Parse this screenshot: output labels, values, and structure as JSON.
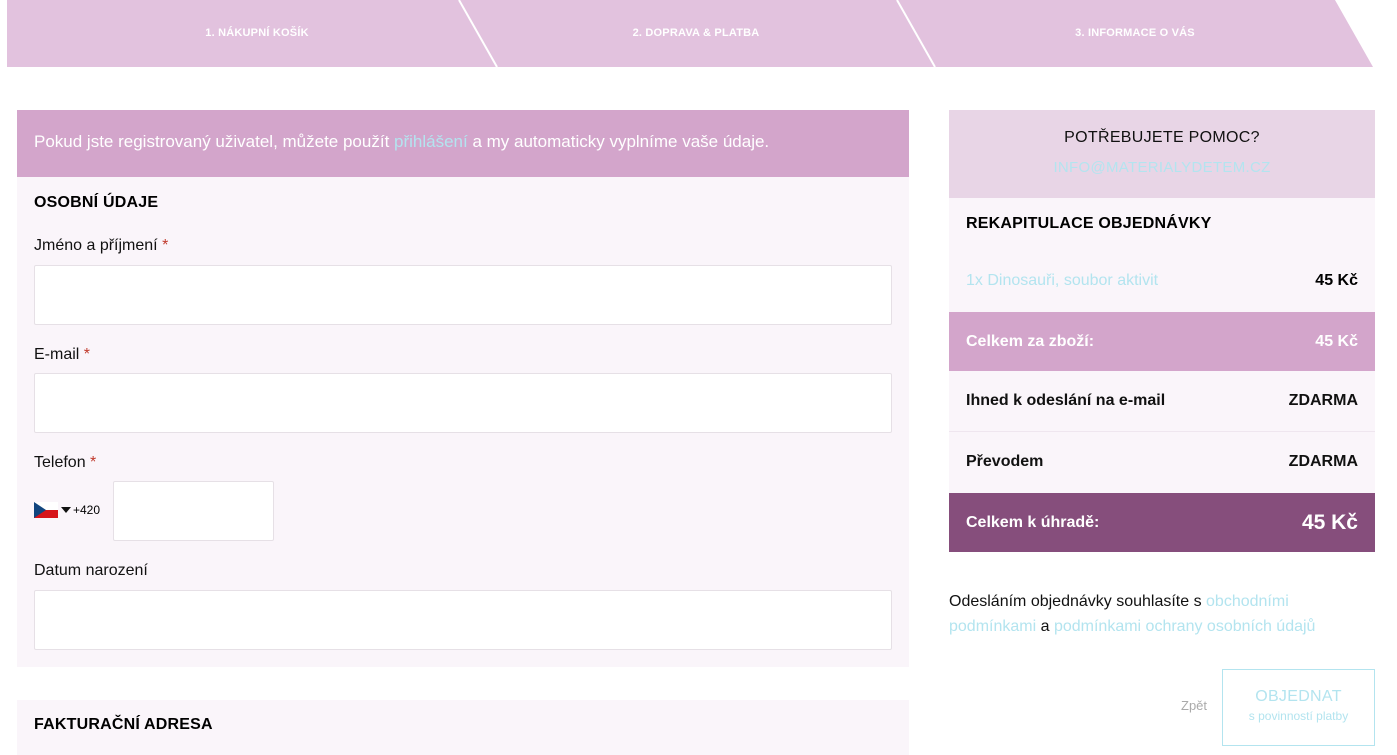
{
  "steps": [
    {
      "label": "1. NÁKUPNÍ KOŠÍK"
    },
    {
      "label": "2. DOPRAVA & PLATBA"
    },
    {
      "label": "3. INFORMACE O VÁS"
    }
  ],
  "login_note": {
    "before": "Pokud jste registrovaný uživatel, můžete použít ",
    "link": "přihlášení",
    "after": " a my automaticky vyplníme vaše údaje."
  },
  "personal": {
    "title": "OSOBNÍ ÚDAJE",
    "name_label": "Jméno a příjmení",
    "email_label": "E-mail",
    "phone_label": "Telefon",
    "phone_prefix": "+420",
    "birth_label": "Datum narození",
    "required_mark": "*"
  },
  "billing": {
    "title": "FAKTURAČNÍ ADRESA"
  },
  "help": {
    "title": "POTŘEBUJETE POMOC?",
    "email": "INFO@MATERIALYDETEM.CZ"
  },
  "recap": {
    "title": "REKAPITULACE OBJEDNÁVKY",
    "item_name": "1x Dinosauři, soubor aktivit",
    "item_price": "45 Kč",
    "subtotal_label": "Celkem za zboží:",
    "subtotal_value": "45 Kč",
    "shipping_label": "Ihned k odeslání na e-mail",
    "shipping_value": "ZDARMA",
    "payment_label": "Převodem",
    "payment_value": "ZDARMA",
    "total_label": "Celkem k úhradě:",
    "total_value": "45 Kč"
  },
  "terms": {
    "before": "Odesláním objednávky souhlasíte s ",
    "link1": "obchodními podmínkami",
    "middle": " a ",
    "link2": "podmínkami ochrany osobních údajů"
  },
  "actions": {
    "back": "Zpět",
    "order": "OBJEDNAT",
    "order_sub": "s povinností platby"
  },
  "colors": {
    "accent_light": "#d3a5cb",
    "accent_dark": "#864e7c",
    "link": "#b3e4ef",
    "help_bg": "#e8d5e6"
  },
  "icons": {
    "flag": "czech-flag-icon",
    "dropdown": "chevron-down-icon"
  }
}
